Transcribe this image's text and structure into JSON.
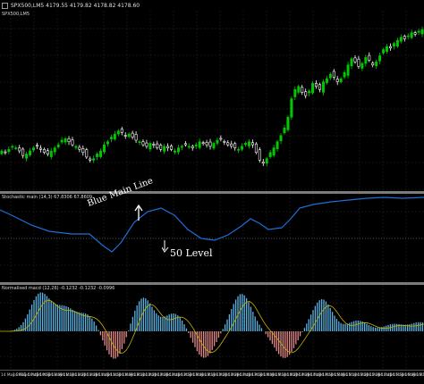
{
  "window": {
    "title": "SPX500,LM5  4179.55 4179.82 4178.82 4178.60",
    "colors": {
      "background": "#000000",
      "bull_candle": "#00c800",
      "bear_candle": "#ffffff",
      "grid": "#2a2a2a"
    }
  },
  "price_pane": {
    "label": "SPX500,LM5",
    "candles_normalized_trend": [
      0.18,
      0.17,
      0.19,
      0.21,
      0.2,
      0.18,
      0.15,
      0.16,
      0.18,
      0.2,
      0.21,
      0.19,
      0.17,
      0.16,
      0.18,
      0.2,
      0.22,
      0.25,
      0.26,
      0.24,
      0.22,
      0.21,
      0.19,
      0.17,
      0.14,
      0.12,
      0.13,
      0.16,
      0.18,
      0.22,
      0.24,
      0.27,
      0.29,
      0.31,
      0.3,
      0.28,
      0.29,
      0.27,
      0.25,
      0.24,
      0.22,
      0.21,
      0.23,
      0.22,
      0.2,
      0.19,
      0.21,
      0.2,
      0.19,
      0.18,
      0.2,
      0.21,
      0.22,
      0.21,
      0.2,
      0.22,
      0.24,
      0.23,
      0.22,
      0.21,
      0.23,
      0.25,
      0.26,
      0.24,
      0.22,
      0.21,
      0.2,
      0.19,
      0.21,
      0.23,
      0.24,
      0.22,
      0.17,
      0.12,
      0.1,
      0.13,
      0.17,
      0.2,
      0.24,
      0.28,
      0.33,
      0.4,
      0.52,
      0.58,
      0.6,
      0.56,
      0.54,
      0.57,
      0.62,
      0.6,
      0.58,
      0.63,
      0.65,
      0.68,
      0.66,
      0.63,
      0.65,
      0.69,
      0.74,
      0.78,
      0.76,
      0.73,
      0.75,
      0.79,
      0.77,
      0.74,
      0.76,
      0.8,
      0.84,
      0.86,
      0.85,
      0.88,
      0.9,
      0.92,
      0.91,
      0.93,
      0.95,
      0.94,
      0.96,
      0.97
    ]
  },
  "stoch_pane": {
    "label": "Stochastic main (14,3) 67.8306 67.8609",
    "line_color": "#1e6fd9",
    "level_color": "#888888"
  },
  "macd_pane": {
    "label": "Normalised macd (12,26) -0.1232 -0.1232 -0.0996",
    "positive_color": "#5ab4e6",
    "negative_color": "#e88a8a",
    "signal_color": "#c8b400"
  },
  "annotations": {
    "blue_main_line": "Blue Main Line",
    "fifty_level": "50 Level",
    "arrow_glyph": "↑"
  },
  "time_axis": {
    "labels": [
      "14 May 2021",
      "14 May 10:40",
      "14 May 10:50",
      "14 May 11:00",
      "14 May 11:10",
      "14 May 11:20",
      "14 May 11:30",
      "14 May 11:40",
      "14 May 11:50",
      "14 May 12:00",
      "14 May 12:10",
      "14 May 12:20",
      "14 May 12:30",
      "14 May 12:40",
      "14 May 12:50",
      "14 May 13:00",
      "14 May 13:10",
      "14 May 13:20",
      "14 May 13:30",
      "14 May 13:40",
      "14 May 13:50",
      "14 May 14:00",
      "14 May 14:10",
      "14 May 14:20",
      "14 May 14:30",
      "14 May 14:40",
      "14 May 14:50",
      "14 May 15:00",
      "14 May 15:10",
      "14 May 15:20",
      "14 May 15:30",
      "14 May 15:40",
      "14 May 15:50",
      "14 May 16:00",
      "14 May 16:10",
      "14 May 16:20"
    ]
  }
}
